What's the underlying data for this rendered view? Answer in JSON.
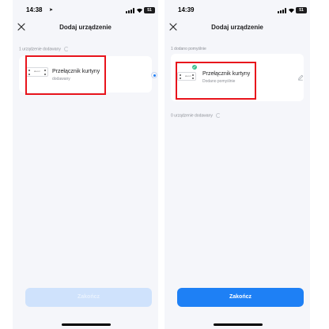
{
  "left": {
    "time": "14:38",
    "battery": "51",
    "title": "Dodaj urządzenie",
    "section_label": "1 urządzenie dodawany",
    "device": {
      "name": "Przełącznik kurtyny",
      "status": "dodawany",
      "thumb_label": "MS-107"
    },
    "button": "Zakończ"
  },
  "right": {
    "time": "14:39",
    "battery": "51",
    "title": "Dodaj urządzenie",
    "section_label": "1 dodano pomyślnie",
    "device": {
      "name": "Przełącznik kurtyny",
      "status": "Dodano pomyślnie",
      "thumb_label": "MS-107"
    },
    "section2_label": "0 urządzenie dodawany",
    "button": "Zakończ"
  },
  "colors": {
    "accent": "#1e80f5",
    "accent_disabled": "#cfe2fc",
    "success": "#3ec08f",
    "highlight": "#e8141c"
  },
  "icons": [
    "location-arrow-icon",
    "signal-icon",
    "wifi-icon",
    "battery-icon",
    "close-icon",
    "spinner-icon",
    "radio-selected-icon",
    "checkmark-icon",
    "edit-pencil-icon"
  ]
}
